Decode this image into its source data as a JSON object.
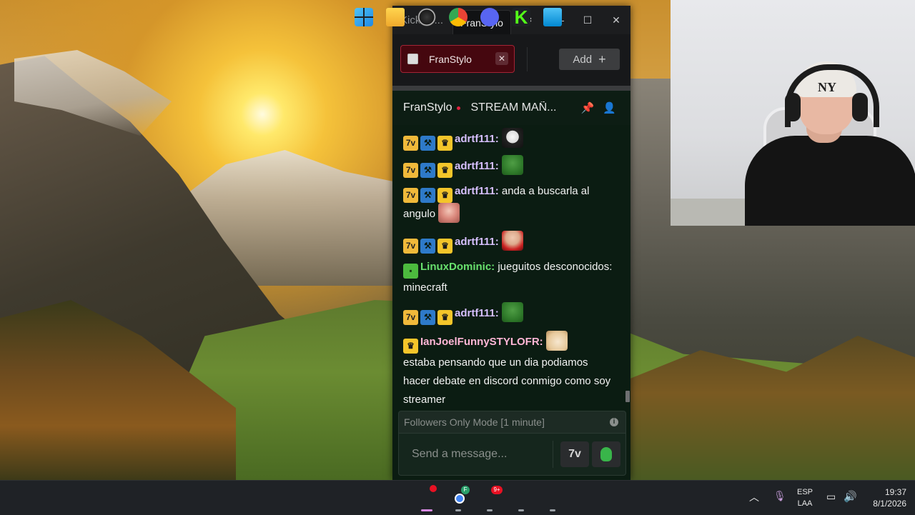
{
  "window": {
    "app_title": "KickTal...",
    "active_tab": "FranStylo",
    "minimize": "—",
    "maximize": "☐",
    "close": "✕"
  },
  "tabs": {
    "channel_tab_label": "FranStylo",
    "channel_tab_close": "✕",
    "add_label": "Add",
    "add_plus": "+"
  },
  "chat_header": {
    "channel": "FranStylo",
    "title": "STREAM MAÑ..."
  },
  "messages": [
    {
      "user": "adrtf111:",
      "text": ""
    },
    {
      "user": "adrtf111:",
      "text": ""
    },
    {
      "user": "adrtf111:",
      "text": " anda a buscarla al angulo"
    },
    {
      "user": "adrtf111:",
      "text": ""
    },
    {
      "user": "LinuxDominic:",
      "text": " jueguitos desconocidos: minecraft"
    },
    {
      "user": "adrtf111:",
      "text": ""
    },
    {
      "user": "IanJoelFunnySTYLOFR:",
      "text": "estaba pensando que un dia podiamos hacer debate en discord conmigo como soy streamer"
    }
  ],
  "composer": {
    "followers_mode": "Followers Only Mode [1 minute]",
    "info_icon": "i",
    "placeholder": "Send a message...",
    "sub_icon_text": "7v"
  },
  "taskbar": {
    "chrome_badge": "F",
    "discord_badge": "9+",
    "lang_line1": "ESP",
    "lang_line2": "LAA",
    "time": "19:37",
    "date": "8/1/2026"
  },
  "icons": {
    "gear": "gear-icon",
    "pin": "pin-icon",
    "user": "user-icon",
    "mic": "mic-icon",
    "network": "network-icon",
    "volume": "volume-icon"
  },
  "colors": {
    "chat_bg": "#0b1c12",
    "tab_active_border": "#a32435",
    "live_dot": "#e0223f",
    "adrtf_color": "#d7c0ff",
    "linux_color": "#68e06d",
    "ian_color": "#ffb6d6",
    "kick_green": "#53fc18"
  }
}
